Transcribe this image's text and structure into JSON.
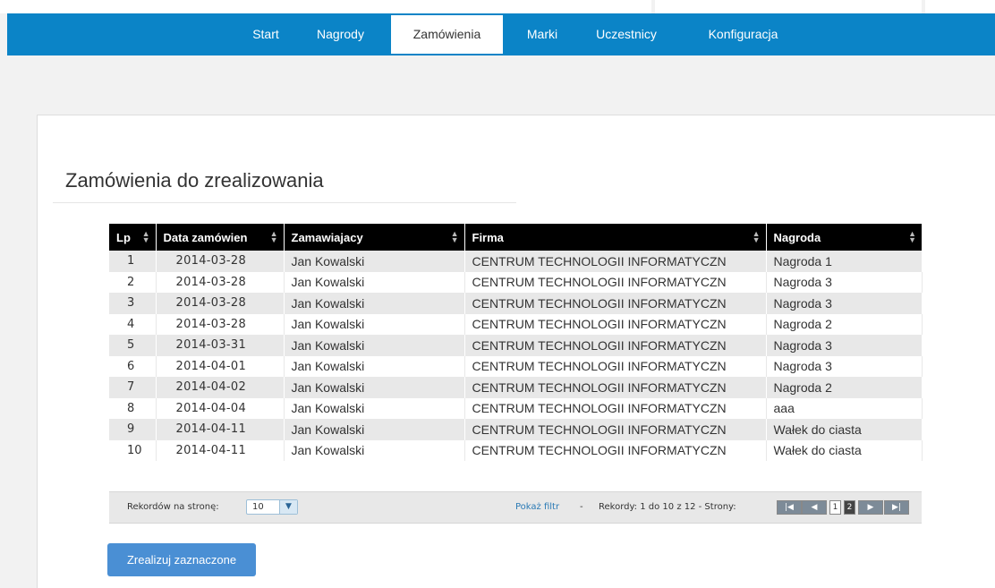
{
  "nav": {
    "items": [
      {
        "label": "Start",
        "active": false
      },
      {
        "label": "Nagrody",
        "active": false
      },
      {
        "label": "Zamówienia",
        "active": true
      },
      {
        "label": "Marki",
        "active": false
      },
      {
        "label": "Uczestnicy",
        "active": false
      },
      {
        "label": "Konfiguracja",
        "active": false
      }
    ],
    "color": "#0b84c7"
  },
  "page": {
    "title": "Zamówienia do zrealizowania"
  },
  "table": {
    "columns": [
      "Lp",
      "Data zamówien",
      "Zamawiajacy",
      "Firma",
      "Nagroda"
    ],
    "rows": [
      [
        "1",
        "2014-03-28",
        "Jan Kowalski",
        "CENTRUM TECHNOLOGII INFORMATYCZN",
        "Nagroda 1"
      ],
      [
        "2",
        "2014-03-28",
        "Jan Kowalski",
        "CENTRUM TECHNOLOGII INFORMATYCZN",
        "Nagroda 3"
      ],
      [
        "3",
        "2014-03-28",
        "Jan Kowalski",
        "CENTRUM TECHNOLOGII INFORMATYCZN",
        "Nagroda 3"
      ],
      [
        "4",
        "2014-03-28",
        "Jan Kowalski",
        "CENTRUM TECHNOLOGII INFORMATYCZN",
        "Nagroda 2"
      ],
      [
        "5",
        "2014-03-31",
        "Jan Kowalski",
        "CENTRUM TECHNOLOGII INFORMATYCZN",
        "Nagroda 3"
      ],
      [
        "6",
        "2014-04-01",
        "Jan Kowalski",
        "CENTRUM TECHNOLOGII INFORMATYCZN",
        "Nagroda 3"
      ],
      [
        "7",
        "2014-04-02",
        "Jan Kowalski",
        "CENTRUM TECHNOLOGII INFORMATYCZN",
        "Nagroda 2"
      ],
      [
        "8",
        "2014-04-04",
        "Jan Kowalski",
        "CENTRUM TECHNOLOGII INFORMATYCZN",
        "aaa"
      ],
      [
        "9",
        "2014-04-11",
        "Jan Kowalski",
        "CENTRUM TECHNOLOGII INFORMATYCZN",
        "Wałek do ciasta"
      ],
      [
        "10",
        "2014-04-11",
        "Jan Kowalski",
        "CENTRUM TECHNOLOGII INFORMATYCZN",
        "Wałek do ciasta"
      ]
    ]
  },
  "pager": {
    "per_page_label": "Rekordów na stronę:",
    "per_page_value": "10",
    "filter_link": "Pokaż filtr",
    "separator": "-",
    "records_text": "Rekordy: 1 do 10 z 12 - Strony:",
    "first_icon": "first-page-icon",
    "prev_icon": "prev-page-icon",
    "next_icon": "next-page-icon",
    "last_icon": "last-page-icon",
    "pages": [
      "1",
      "2"
    ],
    "current_page": "2"
  },
  "actions": {
    "submit_label": "Zrealizuj zaznaczone",
    "submit_color": "#4a8fd4"
  }
}
